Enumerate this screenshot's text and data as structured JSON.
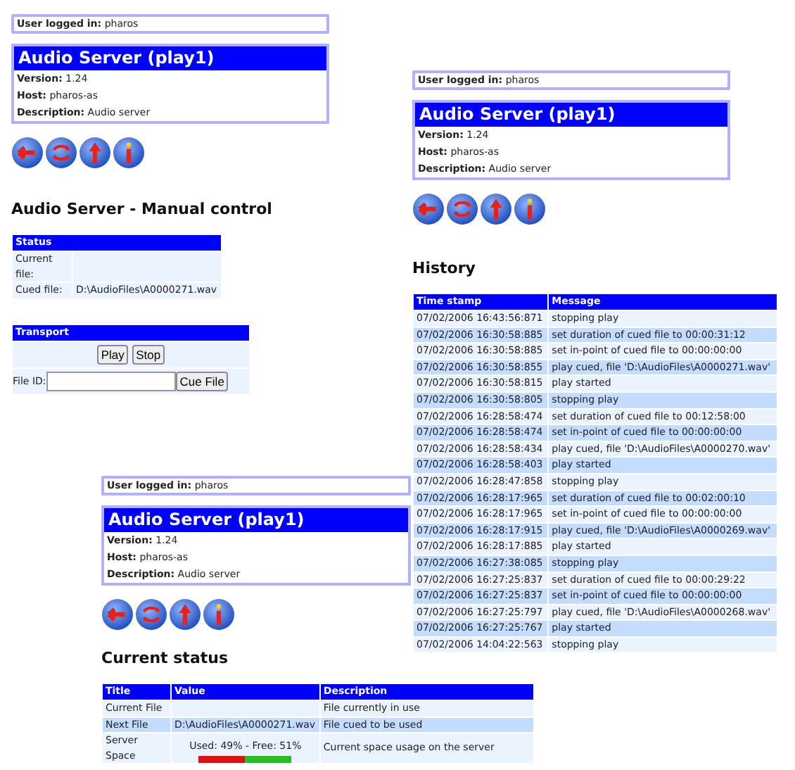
{
  "pages": [
    {
      "kind": "manual_control",
      "user_label": "User logged in:",
      "user": "pharos",
      "server_title": "Audio Server (play1)",
      "details": [
        {
          "label": "Version:",
          "value": "1.24"
        },
        {
          "label": "Host:",
          "value": "pharos-as"
        },
        {
          "label": "Description:",
          "value": "Audio server"
        }
      ],
      "heading": "Audio Server - Manual control",
      "status": {
        "title": "Status",
        "rows": [
          {
            "label": "Current file:"
          },
          {
            "label": "Cued file:",
            "value": "D:\\AudioFiles\\A0000271.wav"
          }
        ]
      },
      "transport": {
        "title": "Transport",
        "buttons": [
          "Play",
          "Stop"
        ],
        "file_id_label": "File ID:",
        "cue_button": "Cue File"
      }
    },
    {
      "kind": "history",
      "user_label": "User logged in:",
      "user": "pharos",
      "server_title": "Audio Server (play1)",
      "details": [
        {
          "label": "Version:",
          "value": "1.24"
        },
        {
          "label": "Host:",
          "value": "pharos-as"
        },
        {
          "label": "Description:",
          "value": "Audio server"
        }
      ],
      "heading": "History",
      "table": {
        "columns": [
          "Time stamp",
          "Message"
        ],
        "rows": [
          [
            "07/02/2006 16:43:56:871",
            "stopping play"
          ],
          [
            "07/02/2006 16:30:58:885",
            "set duration of cued file to 00:00:31:12"
          ],
          [
            "07/02/2006 16:30:58:885",
            "set in-point of cued file to 00:00:00:00"
          ],
          [
            "07/02/2006 16:30:58:855",
            "play cued, file 'D:\\AudioFiles\\A0000271.wav'"
          ],
          [
            "07/02/2006 16:30:58:815",
            "play started"
          ],
          [
            "07/02/2006 16:30:58:805",
            "stopping play"
          ],
          [
            "07/02/2006 16:28:58:474",
            "set duration of cued file to 00:12:58:00"
          ],
          [
            "07/02/2006 16:28:58:474",
            "set in-point of cued file to 00:00:00:00"
          ],
          [
            "07/02/2006 16:28:58:434",
            "play cued, file 'D:\\AudioFiles\\A0000270.wav'"
          ],
          [
            "07/02/2006 16:28:58:403",
            "play started"
          ],
          [
            "07/02/2006 16:28:47:858",
            "stopping play"
          ],
          [
            "07/02/2006 16:28:17:965",
            "set duration of cued file to 00:02:00:10"
          ],
          [
            "07/02/2006 16:28:17:965",
            "set in-point of cued file to 00:00:00:00"
          ],
          [
            "07/02/2006 16:28:17:915",
            "play cued, file 'D:\\AudioFiles\\A0000269.wav'"
          ],
          [
            "07/02/2006 16:28:17:885",
            "play started"
          ],
          [
            "07/02/2006 16:27:38:085",
            "stopping play"
          ],
          [
            "07/02/2006 16:27:25:837",
            "set duration of cued file to 00:00:29:22"
          ],
          [
            "07/02/2006 16:27:25:837",
            "set in-point of cued file to 00:00:00:00"
          ],
          [
            "07/02/2006 16:27:25:797",
            "play cued, file 'D:\\AudioFiles\\A0000268.wav'"
          ],
          [
            "07/02/2006 16:27:25:767",
            "play started"
          ],
          [
            "07/02/2006 14:04:22:563",
            "stopping play"
          ]
        ]
      }
    },
    {
      "kind": "current_status",
      "user_label": "User logged in:",
      "user": "pharos",
      "server_title": "Audio Server (play1)",
      "details": [
        {
          "label": "Version:",
          "value": "1.24"
        },
        {
          "label": "Host:",
          "value": "pharos-as"
        },
        {
          "label": "Description:",
          "value": "Audio server"
        }
      ],
      "heading": "Current status",
      "table": {
        "columns": [
          "Title",
          "Value",
          "Description"
        ],
        "rows": [
          {
            "kind": "text",
            "title": "Current File",
            "description": "File currently in use"
          },
          {
            "kind": "text",
            "title": "Next File",
            "value": "D:\\AudioFiles\\A0000271.wav",
            "description": "File cued to be used"
          },
          {
            "kind": "meter",
            "title": "Server Space",
            "value": "Used: 49% - Free: 51%",
            "level": 0.49,
            "description": "Current space usage on the server"
          }
        ]
      }
    }
  ]
}
